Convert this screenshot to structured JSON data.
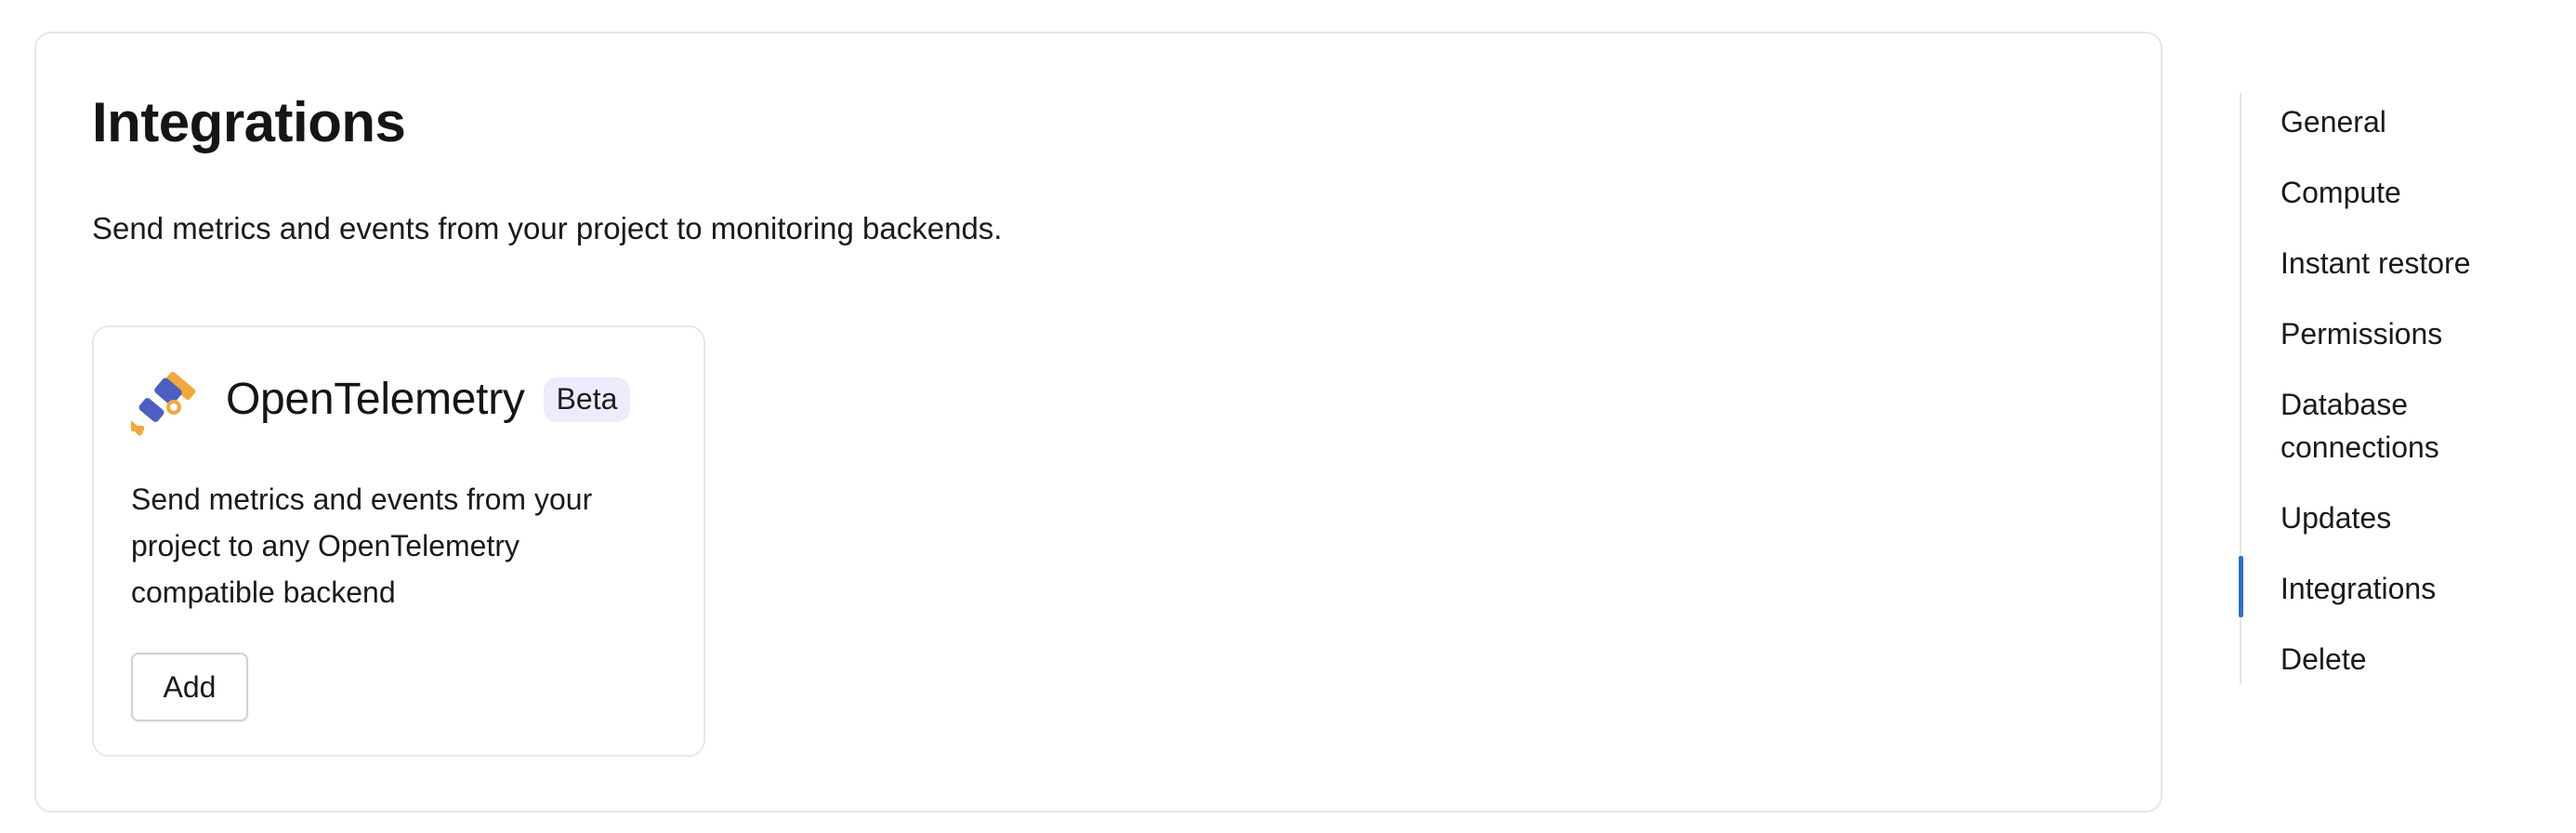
{
  "page": {
    "title": "Integrations",
    "description": "Send metrics and events from your project to monitoring backends."
  },
  "integration_card": {
    "icon": "opentelemetry-logo-icon",
    "title": "OpenTelemetry",
    "badge": "Beta",
    "description": "Send metrics and events from your project to any OpenTelemetry compatible backend",
    "add_label": "Add"
  },
  "sidebar": {
    "items": [
      {
        "label": "General"
      },
      {
        "label": "Compute"
      },
      {
        "label": "Instant restore"
      },
      {
        "label": "Permissions"
      },
      {
        "label": "Database connections"
      },
      {
        "label": "Updates"
      },
      {
        "label": "Integrations",
        "active": true
      },
      {
        "label": "Delete"
      }
    ]
  },
  "colors": {
    "accent": "#2d6ec9",
    "badge_bg": "#efeafe",
    "otel_blue": "#4a5fc1",
    "otel_orange": "#f2a93b"
  }
}
